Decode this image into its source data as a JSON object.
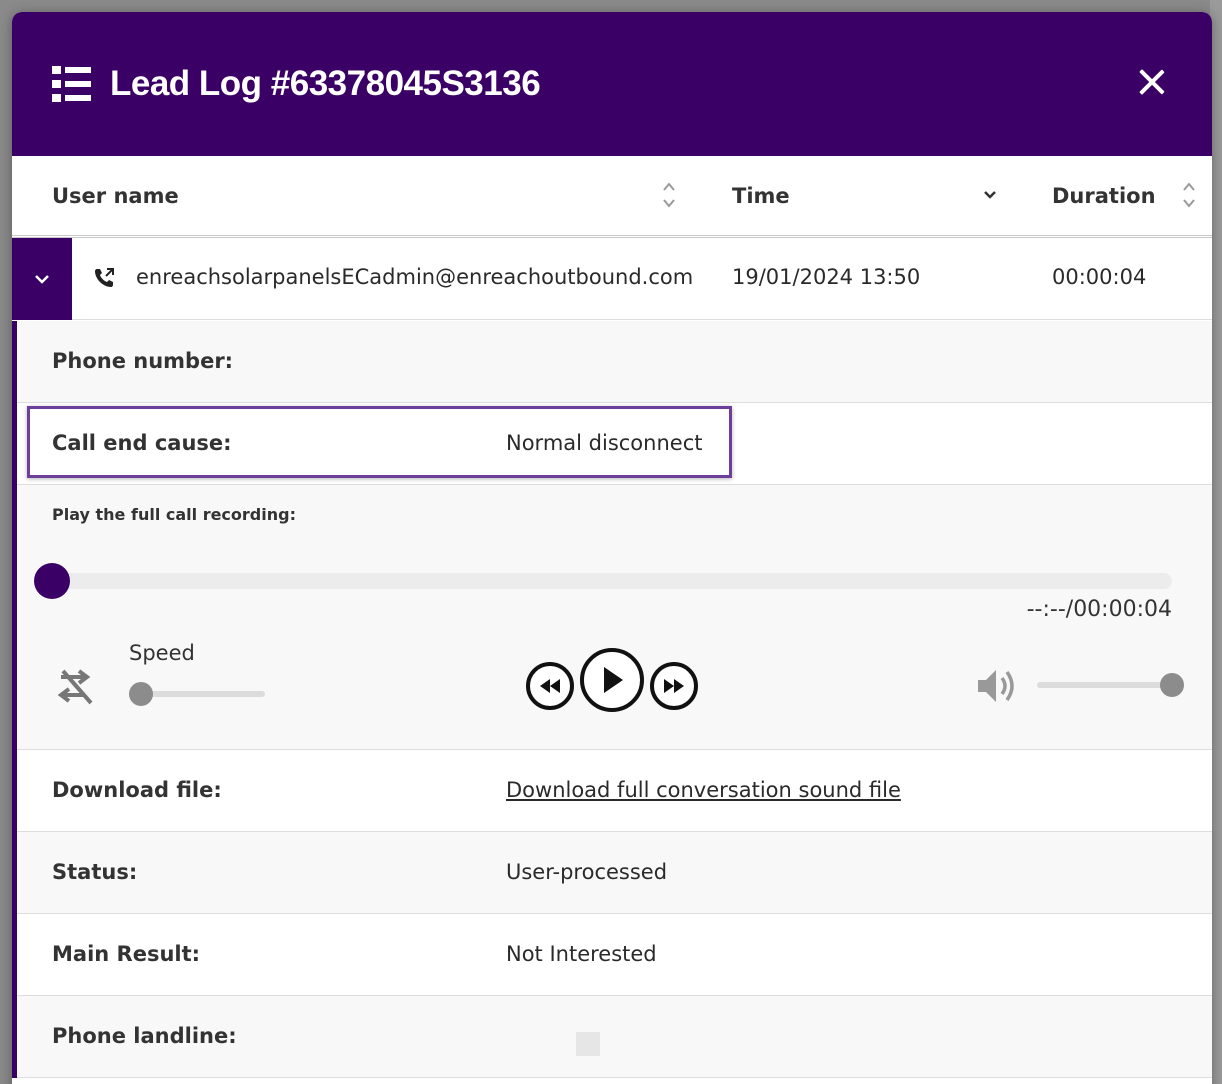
{
  "modal": {
    "title": "Lead Log #63378045S3136",
    "close_label": "×"
  },
  "table": {
    "columns": [
      {
        "label": "User name",
        "sort": "sortable"
      },
      {
        "label": "Time",
        "sort": "descending"
      },
      {
        "label": "Duration",
        "sort": "sortable"
      }
    ],
    "row": {
      "user": "enreachsolarpanelsECadmin@enreachoutbound.com",
      "time": "19/01/2024 13:50",
      "duration": "00:00:04",
      "call_type_icon": "phone-outgoing-icon"
    }
  },
  "details": {
    "phone_number_label": "Phone number:",
    "phone_number_value": "",
    "call_end_cause_label": "Call end cause:",
    "call_end_cause_value": "Normal disconnect",
    "recording_label": "Play the full call recording:",
    "recording_progress": 0.0,
    "recording_time": "--:--/00:00:04",
    "speed_label": "Speed",
    "speed_level": 0.0,
    "volume_level": 1.0,
    "download_label": "Download file:",
    "download_link": "Download full conversation sound file",
    "status_label": "Status:",
    "status_value": "User-processed",
    "main_result_label": "Main Result:",
    "main_result_value": "Not Interested",
    "phone_landline_label": "Phone landline:",
    "phone_landline_value": ""
  },
  "colors": {
    "header_bg": "#3b0066",
    "highlight_border": "#6e3f9a"
  }
}
